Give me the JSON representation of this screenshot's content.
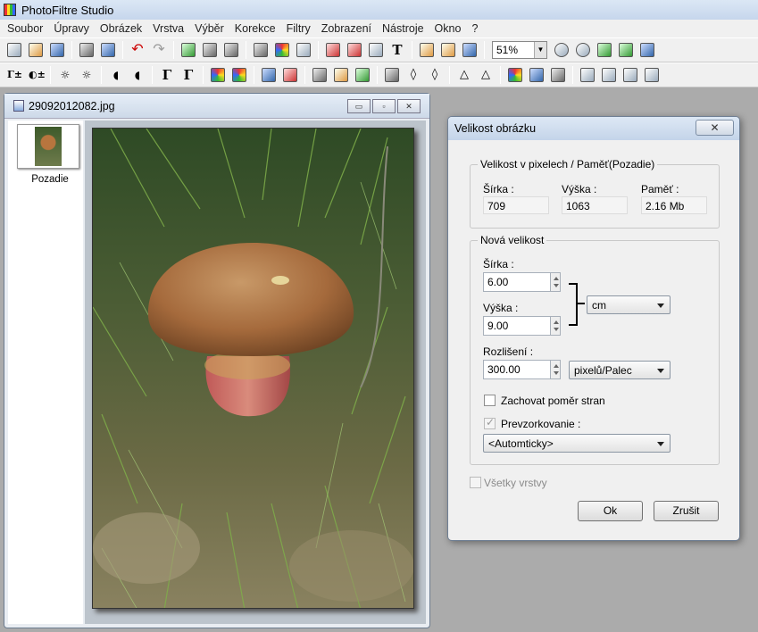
{
  "app": {
    "title": "PhotoFiltre Studio"
  },
  "menu": [
    "Soubor",
    "Úpravy",
    "Obrázek",
    "Vrstva",
    "Výběr",
    "Korekce",
    "Filtry",
    "Zobrazení",
    "Nástroje",
    "Okno",
    "?"
  ],
  "toolbar": {
    "zoom": "51%"
  },
  "icons": {
    "toolbar1": [
      "new-icon",
      "open-icon",
      "save-icon",
      "print-icon",
      "scan-icon",
      "undo-icon",
      "redo-icon",
      "copy-icon",
      "paste-icon",
      "paste-new-icon",
      "gray-swatch-icon",
      "color-grid-icon",
      "transparency-icon",
      "image-size-icon",
      "canvas-size-icon",
      "crop-icon",
      "text-icon",
      "browser-icon",
      "palette-icon",
      "plugin-icon",
      "zoom-in-icon",
      "zoom-out-icon",
      "fit-icon",
      "real-size-icon",
      "fullscreen-icon"
    ],
    "toolbar2": [
      "auto-levels-icon",
      "auto-contrast-icon",
      "brightness-minus-icon",
      "brightness-plus-icon",
      "contrast-minus-icon",
      "contrast-plus-icon",
      "gamma-minus-icon",
      "gamma-plus-icon",
      "saturation-minus-icon",
      "saturation-plus-icon",
      "hue-icon",
      "color-balance-icon",
      "grid-icon",
      "texture-icon",
      "pattern-icon",
      "emboss-icon",
      "drop-icon",
      "drop-outline-icon",
      "sharpen-icon",
      "soften-icon",
      "gradient-icon",
      "fade-icon",
      "stamp-icon",
      "flip-h-icon",
      "flip-v-icon",
      "rotate-icon",
      "rotate-ccw-icon"
    ]
  },
  "document": {
    "filename": "29092012082.jpg",
    "layer_label": "Pozadie",
    "win_min": "▭",
    "win_max": "▫",
    "win_close": "✕"
  },
  "dialog": {
    "title": "Velikost obrázku",
    "close": "✕",
    "current": {
      "legend": "Velikost v pixelech / Paměť(Pozadie)",
      "width_label": "Šírka :",
      "width": "709",
      "height_label": "Výška :",
      "height": "1063",
      "mem_label": "Paměť :",
      "mem": "2.16 Mb"
    },
    "new": {
      "legend": "Nová velikost",
      "width_label": "Šírka :",
      "width": "6.00",
      "height_label": "Výška :",
      "height": "9.00",
      "unit": "cm",
      "res_label": "Rozlišení :",
      "res": "300.00",
      "res_unit": "pixelů/Palec",
      "keep_ratio": "Zachovat poměr stran",
      "resample": "Prevzorkovanie :",
      "resample_mode": "<Automticky>"
    },
    "all_layers": "Všetky vrstvy",
    "ok": "Ok",
    "cancel": "Zrušit"
  }
}
